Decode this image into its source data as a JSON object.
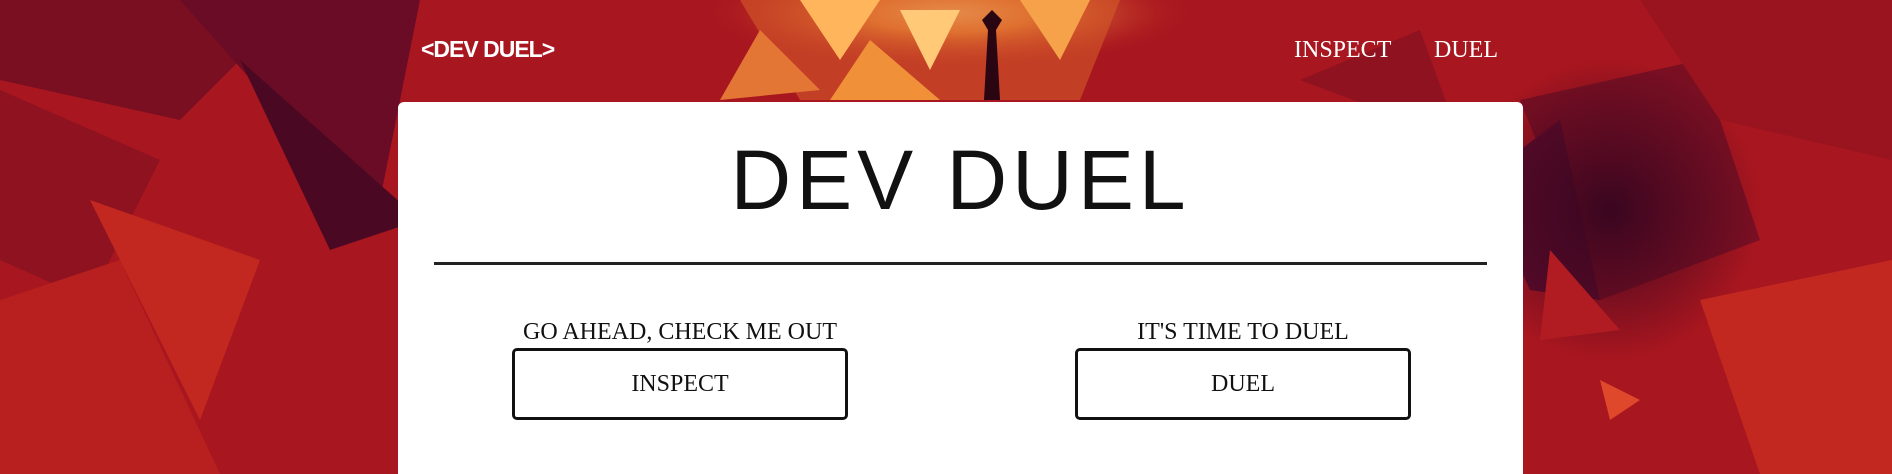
{
  "nav": {
    "logo": "<DEV DUEL>",
    "links": [
      {
        "label": "INSPECT"
      },
      {
        "label": "DUEL"
      }
    ]
  },
  "card": {
    "title": "DEV DUEL",
    "actions": [
      {
        "caption": "GO AHEAD, CHECK ME OUT",
        "button_label": "INSPECT"
      },
      {
        "caption": "IT'S TIME TO DUEL",
        "button_label": "DUEL"
      }
    ]
  },
  "colors": {
    "background_red": "#a8161f",
    "background_dark": "#5a0b2a",
    "accent_orange": "#f0913a",
    "card_bg": "#ffffff",
    "text": "#111111"
  }
}
